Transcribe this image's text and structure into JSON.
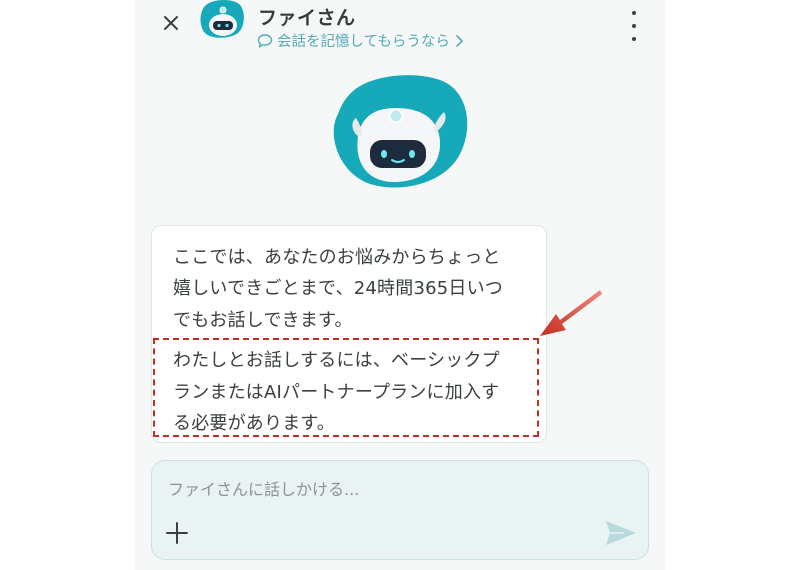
{
  "header": {
    "title": "ファイさん",
    "memory_link": "会話を記憶してもらうなら",
    "close_icon": "close-icon",
    "more_icon": "kebab-menu-icon"
  },
  "message": {
    "lines": [
      "ここでは、あなたのお悩みからちょっと",
      "嬉しいできごとまで、24時間365日いつ",
      "でもお話しできます。",
      "わたしとお話しするには、ベーシックプ",
      "ランまたはAIパートナープランに加入す",
      "る必要があります。"
    ]
  },
  "composer": {
    "placeholder": "ファイさんに話しかける...",
    "value": "",
    "plus_icon": "plus-icon",
    "send_icon": "send-icon"
  },
  "colors": {
    "accent": "#15a9b9",
    "link": "#55a9b6",
    "highlight": "#c62d21",
    "input_bg": "#e9f3f3"
  }
}
